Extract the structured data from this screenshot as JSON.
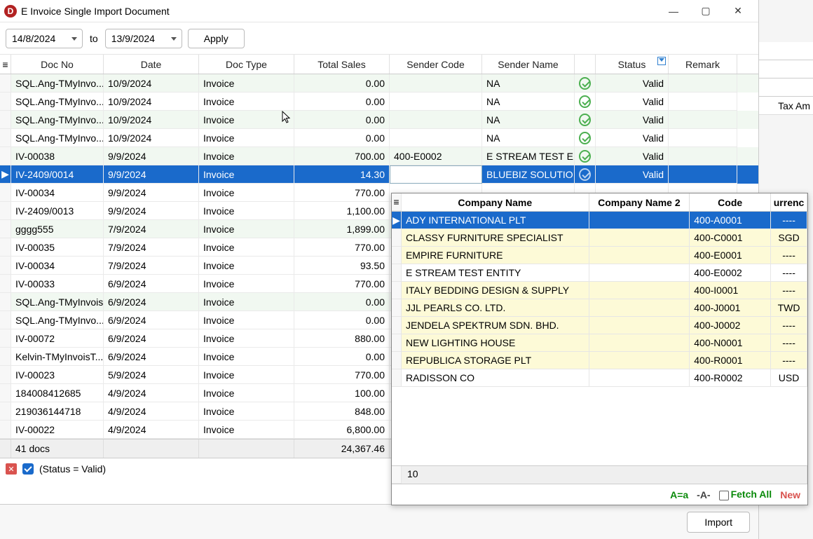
{
  "window": {
    "icon_letter": "D",
    "title": "E Invoice Single Import Document"
  },
  "toolbar": {
    "date_from": "14/8/2024",
    "to_label": "to",
    "date_to": "13/9/2024",
    "apply_label": "Apply"
  },
  "columns": {
    "docno": "Doc No",
    "date": "Date",
    "type": "Doc Type",
    "sales": "Total Sales",
    "scode": "Sender Code",
    "sname": "Sender Name",
    "status": "Status",
    "remark": "Remark"
  },
  "rows": [
    {
      "docno": "SQL.Ang-TMyInvo...",
      "date": "10/9/2024",
      "type": "Invoice",
      "sales": "0.00",
      "scode": "",
      "sname": "NA",
      "status": "Valid",
      "alt": true
    },
    {
      "docno": "SQL.Ang-TMyInvo...",
      "date": "10/9/2024",
      "type": "Invoice",
      "sales": "0.00",
      "scode": "",
      "sname": "NA",
      "status": "Valid",
      "alt": false
    },
    {
      "docno": "SQL.Ang-TMyInvo...",
      "date": "10/9/2024",
      "type": "Invoice",
      "sales": "0.00",
      "scode": "",
      "sname": "NA",
      "status": "Valid",
      "alt": true
    },
    {
      "docno": "SQL.Ang-TMyInvo...",
      "date": "10/9/2024",
      "type": "Invoice",
      "sales": "0.00",
      "scode": "",
      "sname": "NA",
      "status": "Valid",
      "alt": false
    },
    {
      "docno": "IV-00038",
      "date": "9/9/2024",
      "type": "Invoice",
      "sales": "700.00",
      "scode": "400-E0002",
      "sname": "E STREAM TEST E...",
      "status": "Valid",
      "alt": true
    },
    {
      "docno": "IV-2409/0014",
      "date": "9/9/2024",
      "type": "Invoice",
      "sales": "14.30",
      "scode": "",
      "sname": "BLUEBIZ SOLUTIO...",
      "status": "Valid",
      "selected": true
    },
    {
      "docno": "IV-00034",
      "date": "9/9/2024",
      "type": "Invoice",
      "sales": "770.00",
      "scode": "",
      "sname": "",
      "status": "",
      "alt": false
    },
    {
      "docno": "IV-2409/0013",
      "date": "9/9/2024",
      "type": "Invoice",
      "sales": "1,100.00",
      "scode": "",
      "sname": "",
      "status": "",
      "alt": false
    },
    {
      "docno": "gggg555",
      "date": "7/9/2024",
      "type": "Invoice",
      "sales": "1,899.00",
      "scode": "",
      "sname": "",
      "status": "",
      "alt": true
    },
    {
      "docno": "IV-00035",
      "date": "7/9/2024",
      "type": "Invoice",
      "sales": "770.00",
      "scode": "",
      "sname": "",
      "status": "",
      "alt": false
    },
    {
      "docno": "IV-00034",
      "date": "7/9/2024",
      "type": "Invoice",
      "sales": "93.50",
      "scode": "",
      "sname": "",
      "status": "",
      "alt": false
    },
    {
      "docno": "IV-00033",
      "date": "6/9/2024",
      "type": "Invoice",
      "sales": "770.00",
      "scode": "",
      "sname": "",
      "status": "",
      "alt": false
    },
    {
      "docno": "SQL.Ang-TMyInvois...",
      "date": "6/9/2024",
      "type": "Invoice",
      "sales": "0.00",
      "scode": "",
      "sname": "",
      "status": "",
      "alt": true
    },
    {
      "docno": "SQL.Ang-TMyInvo...",
      "date": "6/9/2024",
      "type": "Invoice",
      "sales": "0.00",
      "scode": "",
      "sname": "",
      "status": "",
      "alt": false
    },
    {
      "docno": "IV-00072",
      "date": "6/9/2024",
      "type": "Invoice",
      "sales": "880.00",
      "scode": "",
      "sname": "",
      "status": "",
      "alt": false
    },
    {
      "docno": "Kelvin-TMyInvoisT...",
      "date": "6/9/2024",
      "type": "Invoice",
      "sales": "0.00",
      "scode": "",
      "sname": "",
      "status": "",
      "alt": false
    },
    {
      "docno": "IV-00023",
      "date": "5/9/2024",
      "type": "Invoice",
      "sales": "770.00",
      "scode": "",
      "sname": "",
      "status": "",
      "alt": false
    },
    {
      "docno": "184008412685",
      "date": "4/9/2024",
      "type": "Invoice",
      "sales": "100.00",
      "scode": "",
      "sname": "",
      "status": "",
      "alt": false
    },
    {
      "docno": "219036144718",
      "date": "4/9/2024",
      "type": "Invoice",
      "sales": "848.00",
      "scode": "",
      "sname": "",
      "status": "",
      "alt": false
    },
    {
      "docno": "IV-00022",
      "date": "4/9/2024",
      "type": "Invoice",
      "sales": "6,800.00",
      "scode": "",
      "sname": "",
      "status": "",
      "alt": false
    }
  ],
  "footer": {
    "count": "41 docs",
    "total": "24,367.46"
  },
  "filter_bar": {
    "text": "(Status = Valid)"
  },
  "import_button": "Import",
  "side": {
    "col": "Tax Am"
  },
  "popup": {
    "columns": {
      "name": "Company Name",
      "name2": "Company Name 2",
      "code": "Code",
      "cur": "urrenc"
    },
    "rows": [
      {
        "name": "ADY INTERNATIONAL PLT",
        "name2": "",
        "code": "400-A0001",
        "cur": "----",
        "selected": true
      },
      {
        "name": "CLASSY FURNITURE SPECIALIST",
        "name2": "",
        "code": "400-C0001",
        "cur": "SGD",
        "alt": true
      },
      {
        "name": "EMPIRE FURNITURE",
        "name2": "",
        "code": "400-E0001",
        "cur": "----",
        "alt": true
      },
      {
        "name": "E STREAM TEST ENTITY",
        "name2": "",
        "code": "400-E0002",
        "cur": "----"
      },
      {
        "name": "ITALY BEDDING DESIGN & SUPPLY",
        "name2": "",
        "code": "400-I0001",
        "cur": "----",
        "alt": true
      },
      {
        "name": "JJL PEARLS CO. LTD.",
        "name2": "",
        "code": "400-J0001",
        "cur": "TWD",
        "alt": true
      },
      {
        "name": "JENDELA SPEKTRUM SDN. BHD.",
        "name2": "",
        "code": "400-J0002",
        "cur": "----",
        "alt": true
      },
      {
        "name": "NEW LIGHTING HOUSE",
        "name2": "",
        "code": "400-N0001",
        "cur": "----",
        "alt": true
      },
      {
        "name": "REPUBLICA STORAGE PLT",
        "name2": "",
        "code": "400-R0001",
        "cur": "----",
        "alt": true
      },
      {
        "name": "RADISSON CO",
        "name2": "",
        "code": "400-R0002",
        "cur": "USD"
      }
    ],
    "footer_count": "10",
    "aeq": "A=a",
    "adash": "-A-",
    "fetch": "Fetch All",
    "newlink": "New"
  }
}
